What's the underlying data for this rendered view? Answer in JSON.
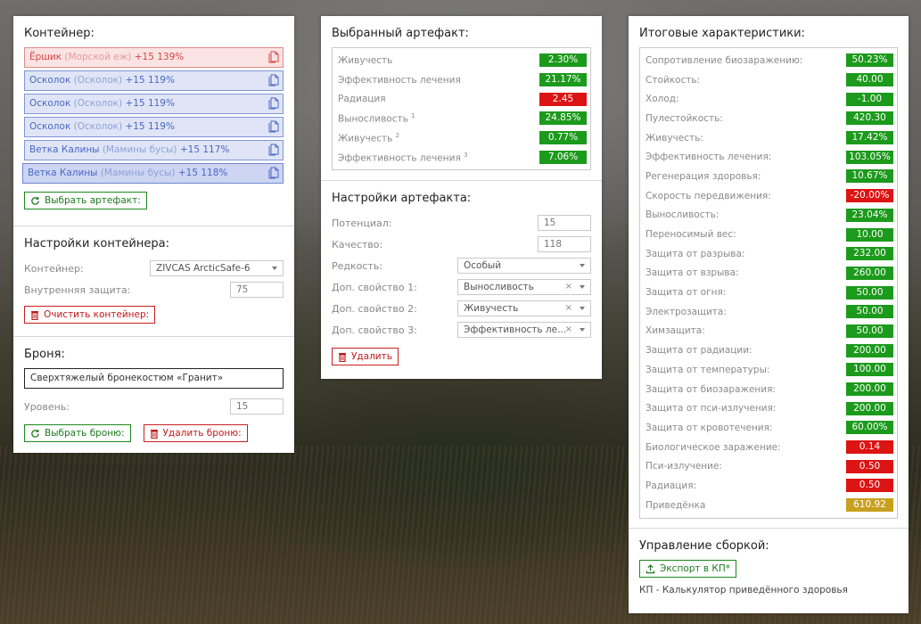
{
  "container_panel": {
    "title": "Контейнер:",
    "slots": [
      {
        "name": "Ёршик",
        "sub": "(Морской еж)",
        "level": "+15 139%",
        "style": "red"
      },
      {
        "name": "Осколок",
        "sub": "(Осколок)",
        "level": "+15 119%",
        "style": "blue"
      },
      {
        "name": "Осколок",
        "sub": "(Осколок)",
        "level": "+15 119%",
        "style": "blue"
      },
      {
        "name": "Осколок",
        "sub": "(Осколок)",
        "level": "+15 119%",
        "style": "blue"
      },
      {
        "name": "Ветка Калины",
        "sub": "(Мамины бусы)",
        "level": "+15 117%",
        "style": "blue"
      },
      {
        "name": "Ветка Калины",
        "sub": "(Мамины бусы)",
        "level": "+15 118%",
        "style": "blue-dark"
      }
    ],
    "select_artifact_button": "Выбрать артефакт:"
  },
  "container_settings": {
    "title": "Настройки контейнера:",
    "container_label": "Контейнер:",
    "container_value": "ZIVCAS ArcticSafe-6",
    "protection_label": "Внутренняя защита:",
    "protection_value": "75",
    "clear_button": "Очистить контейнер:"
  },
  "armor": {
    "title": "Броня:",
    "armor_value": "Сверхтяжелый бронекостюм «Гранит»",
    "level_label": "Уровень:",
    "level_value": "15",
    "select_button": "Выбрать броню:",
    "delete_button": "Удалить броню:"
  },
  "selected_artifact": {
    "title": "Выбранный артефакт:",
    "stats": [
      {
        "name": "Живучесть",
        "sup": "",
        "value": "2.30%",
        "color": "green"
      },
      {
        "name": "Эффективность лечения",
        "sup": "",
        "value": "21.17%",
        "color": "green"
      },
      {
        "name": "Радиация",
        "sup": "",
        "value": "2.45",
        "color": "red"
      },
      {
        "name": "Выносливость",
        "sup": "1",
        "value": "24.85%",
        "color": "green"
      },
      {
        "name": "Живучесть",
        "sup": "2",
        "value": "0.77%",
        "color": "green"
      },
      {
        "name": "Эффективность лечения",
        "sup": "3",
        "value": "7.06%",
        "color": "green"
      }
    ]
  },
  "artifact_settings": {
    "title": "Настройки артефакта:",
    "potential_label": "Потенциал:",
    "potential_value": "15",
    "quality_label": "Качество:",
    "quality_value": "118",
    "rarity_label": "Редкость:",
    "rarity_value": "Особый",
    "prop1_label": "Доп. свойство 1:",
    "prop1_value": "Выносливость",
    "prop2_label": "Доп. свойство 2:",
    "prop2_value": "Живучесть",
    "prop3_label": "Доп. свойство 3:",
    "prop3_value": "Эффективность ле...",
    "clear_symbol": "×",
    "delete_button": "Удалить"
  },
  "totals": {
    "title": "Итоговые характеристики:",
    "stats": [
      {
        "name": "Сопротивление биозаражению:",
        "value": "50.23%",
        "color": "green"
      },
      {
        "name": "Стойкость:",
        "value": "40.00",
        "color": "green"
      },
      {
        "name": "Холод:",
        "value": "-1.00",
        "color": "green"
      },
      {
        "name": "Пулестойкость:",
        "value": "420.30",
        "color": "green"
      },
      {
        "name": "Живучесть:",
        "value": "17.42%",
        "color": "green"
      },
      {
        "name": "Эффективность лечения:",
        "value": "103.05%",
        "color": "green"
      },
      {
        "name": "Регенерация здоровья:",
        "value": "10.67%",
        "color": "green"
      },
      {
        "name": "Скорость передвижения:",
        "value": "-20.00%",
        "color": "red"
      },
      {
        "name": "Выносливость:",
        "value": "23.04%",
        "color": "green"
      },
      {
        "name": "Переносимый вес:",
        "value": "10.00",
        "color": "green"
      },
      {
        "name": "Защита от разрыва:",
        "value": "232.00",
        "color": "green"
      },
      {
        "name": "Защита от взрыва:",
        "value": "260.00",
        "color": "green"
      },
      {
        "name": "Защита от огня:",
        "value": "50.00",
        "color": "green"
      },
      {
        "name": "Электрозащита:",
        "value": "50.00",
        "color": "green"
      },
      {
        "name": "Химзащита:",
        "value": "50.00",
        "color": "green"
      },
      {
        "name": "Защита от радиации:",
        "value": "200.00",
        "color": "green"
      },
      {
        "name": "Защита от температуры:",
        "value": "100.00",
        "color": "green"
      },
      {
        "name": "Защита от биозаражения:",
        "value": "200.00",
        "color": "green"
      },
      {
        "name": "Защита от пси-излучения:",
        "value": "200.00",
        "color": "green"
      },
      {
        "name": "Защита от кровотечения:",
        "value": "60.00%",
        "color": "green"
      },
      {
        "name": "Биологическое заражение:",
        "value": "0.14",
        "color": "red"
      },
      {
        "name": "Пси-излучение:",
        "value": "0.50",
        "color": "red"
      },
      {
        "name": "Радиация:",
        "value": "0.50",
        "color": "red"
      },
      {
        "name": "Приведёнка",
        "value": "610.92",
        "color": "yellow"
      }
    ]
  },
  "build_management": {
    "title": "Управление сборкой:",
    "export_button": "Экспорт в КП*",
    "footnote": "КП - Калькулятор приведённого здоровья"
  },
  "colors": {
    "green": "#1c9a1c",
    "red": "#dc1414",
    "yellow": "#c8a020",
    "slot_blue": "#dfe5f6",
    "slot_red": "#fbe3e3"
  }
}
